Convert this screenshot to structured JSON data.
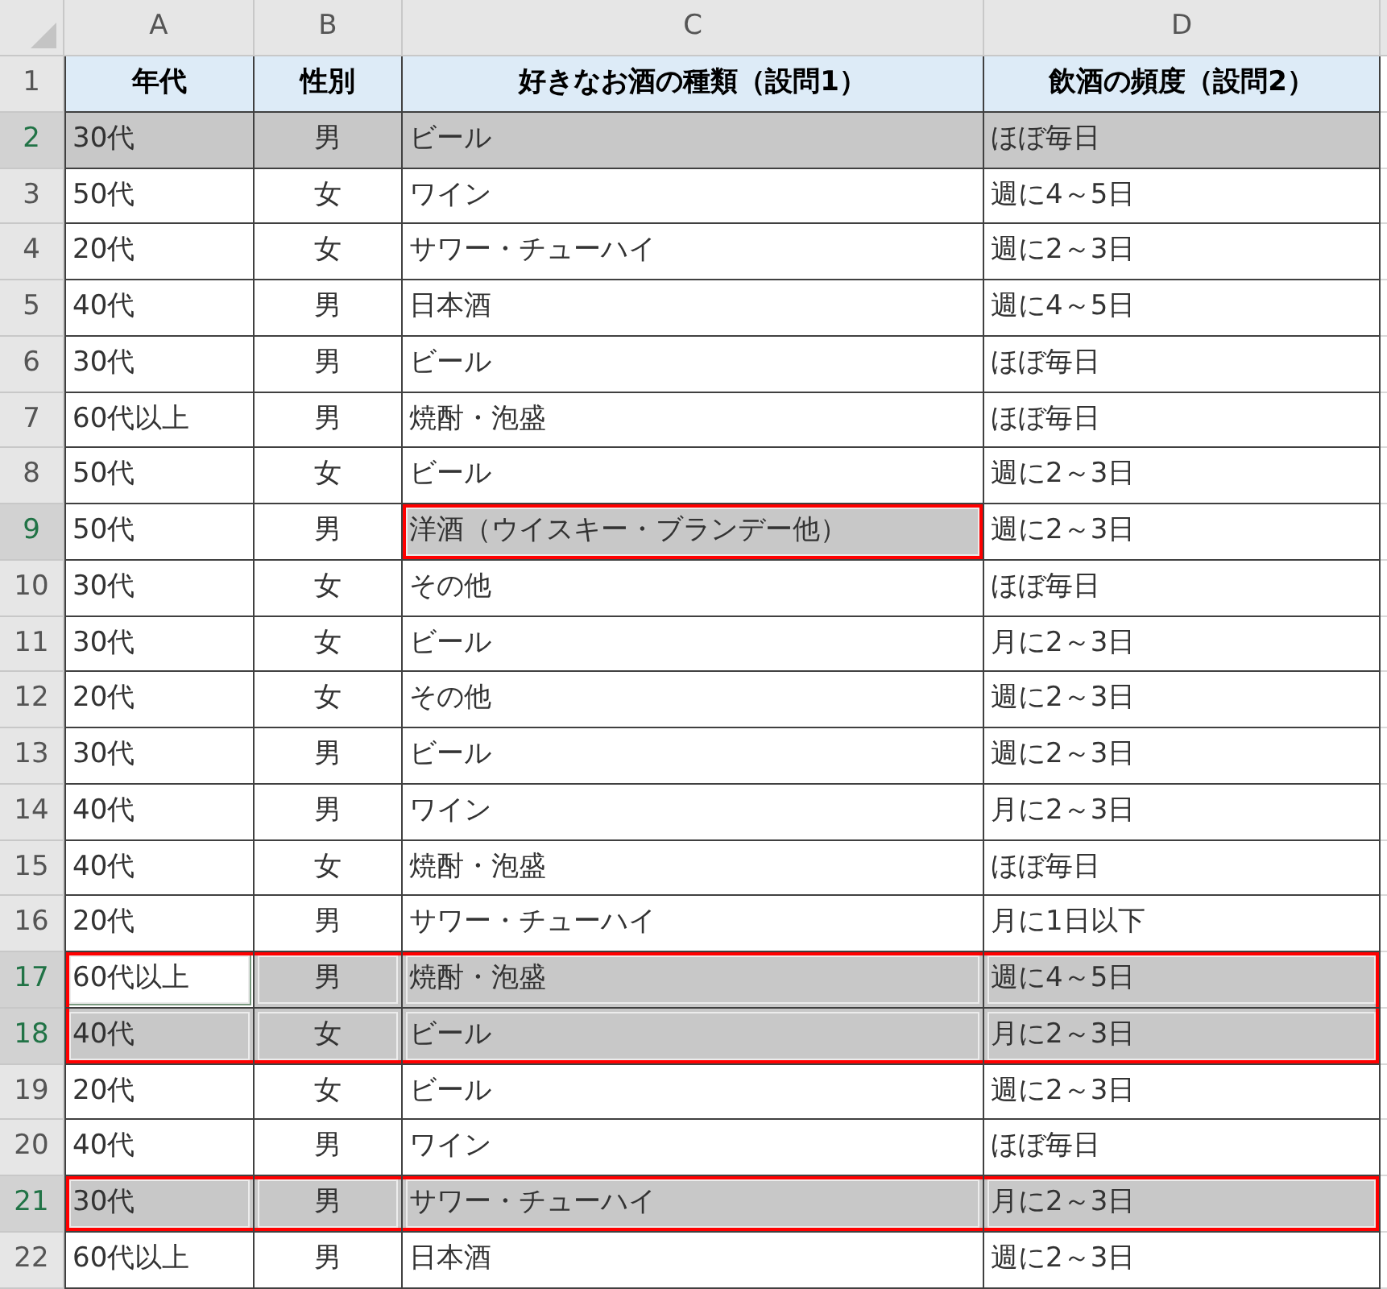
{
  "columns": [
    {
      "label": "A"
    },
    {
      "label": "B"
    },
    {
      "label": "C"
    },
    {
      "label": "D"
    }
  ],
  "rows": [
    {
      "number": "1",
      "kind": "heading",
      "cells": [
        {
          "text": "年代",
          "selected": false,
          "outlined": false,
          "active": false
        },
        {
          "text": "性別",
          "selected": false,
          "outlined": false,
          "active": false
        },
        {
          "text": "好きなお酒の種類（設問1）",
          "selected": false,
          "outlined": false,
          "active": false
        },
        {
          "text": "飲酒の頻度（設問2）",
          "selected": false,
          "outlined": false,
          "active": false
        }
      ]
    },
    {
      "number": "2",
      "kind": "data",
      "cells": [
        {
          "text": "30代",
          "selected": true,
          "outlined": false,
          "active": false
        },
        {
          "text": "男",
          "selected": true,
          "outlined": false,
          "active": false
        },
        {
          "text": "ビール",
          "selected": true,
          "outlined": false,
          "active": false
        },
        {
          "text": "ほぼ毎日",
          "selected": true,
          "outlined": false,
          "active": false
        }
      ]
    },
    {
      "number": "3",
      "kind": "data",
      "cells": [
        {
          "text": "50代",
          "selected": false,
          "outlined": false,
          "active": false
        },
        {
          "text": "女",
          "selected": false,
          "outlined": false,
          "active": false
        },
        {
          "text": "ワイン",
          "selected": false,
          "outlined": false,
          "active": false
        },
        {
          "text": "週に4～5日",
          "selected": false,
          "outlined": false,
          "active": false
        }
      ]
    },
    {
      "number": "4",
      "kind": "data",
      "cells": [
        {
          "text": "20代",
          "selected": false,
          "outlined": false,
          "active": false
        },
        {
          "text": "女",
          "selected": false,
          "outlined": false,
          "active": false
        },
        {
          "text": "サワー・チューハイ",
          "selected": false,
          "outlined": false,
          "active": false
        },
        {
          "text": "週に2～3日",
          "selected": false,
          "outlined": false,
          "active": false
        }
      ]
    },
    {
      "number": "5",
      "kind": "data",
      "cells": [
        {
          "text": "40代",
          "selected": false,
          "outlined": false,
          "active": false
        },
        {
          "text": "男",
          "selected": false,
          "outlined": false,
          "active": false
        },
        {
          "text": "日本酒",
          "selected": false,
          "outlined": false,
          "active": false
        },
        {
          "text": "週に4～5日",
          "selected": false,
          "outlined": false,
          "active": false
        }
      ]
    },
    {
      "number": "6",
      "kind": "data",
      "cells": [
        {
          "text": "30代",
          "selected": false,
          "outlined": false,
          "active": false
        },
        {
          "text": "男",
          "selected": false,
          "outlined": false,
          "active": false
        },
        {
          "text": "ビール",
          "selected": false,
          "outlined": false,
          "active": false
        },
        {
          "text": "ほぼ毎日",
          "selected": false,
          "outlined": false,
          "active": false
        }
      ]
    },
    {
      "number": "7",
      "kind": "data",
      "cells": [
        {
          "text": "60代以上",
          "selected": false,
          "outlined": false,
          "active": false
        },
        {
          "text": "男",
          "selected": false,
          "outlined": false,
          "active": false
        },
        {
          "text": "焼酎・泡盛",
          "selected": false,
          "outlined": false,
          "active": false
        },
        {
          "text": "ほぼ毎日",
          "selected": false,
          "outlined": false,
          "active": false
        }
      ]
    },
    {
      "number": "8",
      "kind": "data",
      "cells": [
        {
          "text": "50代",
          "selected": false,
          "outlined": false,
          "active": false
        },
        {
          "text": "女",
          "selected": false,
          "outlined": false,
          "active": false
        },
        {
          "text": "ビール",
          "selected": false,
          "outlined": false,
          "active": false
        },
        {
          "text": "週に2～3日",
          "selected": false,
          "outlined": false,
          "active": false
        }
      ]
    },
    {
      "number": "9",
      "kind": "data",
      "cells": [
        {
          "text": "50代",
          "selected": false,
          "outlined": false,
          "active": false
        },
        {
          "text": "男",
          "selected": false,
          "outlined": false,
          "active": false
        },
        {
          "text": "洋酒（ウイスキー・ブランデー他）",
          "selected": true,
          "outlined": true,
          "active": false
        },
        {
          "text": "週に2～3日",
          "selected": false,
          "outlined": false,
          "active": false
        }
      ]
    },
    {
      "number": "10",
      "kind": "data",
      "cells": [
        {
          "text": "30代",
          "selected": false,
          "outlined": false,
          "active": false
        },
        {
          "text": "女",
          "selected": false,
          "outlined": false,
          "active": false
        },
        {
          "text": "その他",
          "selected": false,
          "outlined": false,
          "active": false
        },
        {
          "text": "ほぼ毎日",
          "selected": false,
          "outlined": false,
          "active": false
        }
      ]
    },
    {
      "number": "11",
      "kind": "data",
      "cells": [
        {
          "text": "30代",
          "selected": false,
          "outlined": false,
          "active": false
        },
        {
          "text": "女",
          "selected": false,
          "outlined": false,
          "active": false
        },
        {
          "text": "ビール",
          "selected": false,
          "outlined": false,
          "active": false
        },
        {
          "text": "月に2～3日",
          "selected": false,
          "outlined": false,
          "active": false
        }
      ]
    },
    {
      "number": "12",
      "kind": "data",
      "cells": [
        {
          "text": "20代",
          "selected": false,
          "outlined": false,
          "active": false
        },
        {
          "text": "女",
          "selected": false,
          "outlined": false,
          "active": false
        },
        {
          "text": "その他",
          "selected": false,
          "outlined": false,
          "active": false
        },
        {
          "text": "週に2～3日",
          "selected": false,
          "outlined": false,
          "active": false
        }
      ]
    },
    {
      "number": "13",
      "kind": "data",
      "cells": [
        {
          "text": "30代",
          "selected": false,
          "outlined": false,
          "active": false
        },
        {
          "text": "男",
          "selected": false,
          "outlined": false,
          "active": false
        },
        {
          "text": "ビール",
          "selected": false,
          "outlined": false,
          "active": false
        },
        {
          "text": "週に2～3日",
          "selected": false,
          "outlined": false,
          "active": false
        }
      ]
    },
    {
      "number": "14",
      "kind": "data",
      "cells": [
        {
          "text": "40代",
          "selected": false,
          "outlined": false,
          "active": false
        },
        {
          "text": "男",
          "selected": false,
          "outlined": false,
          "active": false
        },
        {
          "text": "ワイン",
          "selected": false,
          "outlined": false,
          "active": false
        },
        {
          "text": "月に2～3日",
          "selected": false,
          "outlined": false,
          "active": false
        }
      ]
    },
    {
      "number": "15",
      "kind": "data",
      "cells": [
        {
          "text": "40代",
          "selected": false,
          "outlined": false,
          "active": false
        },
        {
          "text": "女",
          "selected": false,
          "outlined": false,
          "active": false
        },
        {
          "text": "焼酎・泡盛",
          "selected": false,
          "outlined": false,
          "active": false
        },
        {
          "text": "ほぼ毎日",
          "selected": false,
          "outlined": false,
          "active": false
        }
      ]
    },
    {
      "number": "16",
      "kind": "data",
      "cells": [
        {
          "text": "20代",
          "selected": false,
          "outlined": false,
          "active": false
        },
        {
          "text": "男",
          "selected": false,
          "outlined": false,
          "active": false
        },
        {
          "text": "サワー・チューハイ",
          "selected": false,
          "outlined": false,
          "active": false
        },
        {
          "text": "月に1日以下",
          "selected": false,
          "outlined": false,
          "active": false
        }
      ]
    },
    {
      "number": "17",
      "kind": "data",
      "cells": [
        {
          "text": "60代以上",
          "selected": true,
          "outlined": true,
          "active": true
        },
        {
          "text": "男",
          "selected": true,
          "outlined": true,
          "active": false
        },
        {
          "text": "焼酎・泡盛",
          "selected": true,
          "outlined": true,
          "active": false
        },
        {
          "text": "週に4～5日",
          "selected": true,
          "outlined": true,
          "active": false
        }
      ]
    },
    {
      "number": "18",
      "kind": "data",
      "cells": [
        {
          "text": "40代",
          "selected": true,
          "outlined": true,
          "active": false
        },
        {
          "text": "女",
          "selected": true,
          "outlined": true,
          "active": false
        },
        {
          "text": "ビール",
          "selected": true,
          "outlined": true,
          "active": false
        },
        {
          "text": "月に2～3日",
          "selected": true,
          "outlined": true,
          "active": false
        }
      ]
    },
    {
      "number": "19",
      "kind": "data",
      "cells": [
        {
          "text": "20代",
          "selected": false,
          "outlined": false,
          "active": false
        },
        {
          "text": "女",
          "selected": false,
          "outlined": false,
          "active": false
        },
        {
          "text": "ビール",
          "selected": false,
          "outlined": false,
          "active": false
        },
        {
          "text": "週に2～3日",
          "selected": false,
          "outlined": false,
          "active": false
        }
      ]
    },
    {
      "number": "20",
      "kind": "data",
      "cells": [
        {
          "text": "40代",
          "selected": false,
          "outlined": false,
          "active": false
        },
        {
          "text": "男",
          "selected": false,
          "outlined": false,
          "active": false
        },
        {
          "text": "ワイン",
          "selected": false,
          "outlined": false,
          "active": false
        },
        {
          "text": "ほぼ毎日",
          "selected": false,
          "outlined": false,
          "active": false
        }
      ]
    },
    {
      "number": "21",
      "kind": "data",
      "cells": [
        {
          "text": "30代",
          "selected": true,
          "outlined": true,
          "active": false
        },
        {
          "text": "男",
          "selected": true,
          "outlined": true,
          "active": false
        },
        {
          "text": "サワー・チューハイ",
          "selected": true,
          "outlined": true,
          "active": false
        },
        {
          "text": "月に2～3日",
          "selected": true,
          "outlined": true,
          "active": false
        }
      ]
    },
    {
      "number": "22",
      "kind": "data",
      "cells": [
        {
          "text": "60代以上",
          "selected": false,
          "outlined": false,
          "active": false
        },
        {
          "text": "男",
          "selected": false,
          "outlined": false,
          "active": false
        },
        {
          "text": "日本酒",
          "selected": false,
          "outlined": false,
          "active": false
        },
        {
          "text": "週に2～3日",
          "selected": false,
          "outlined": false,
          "active": false
        }
      ]
    }
  ]
}
